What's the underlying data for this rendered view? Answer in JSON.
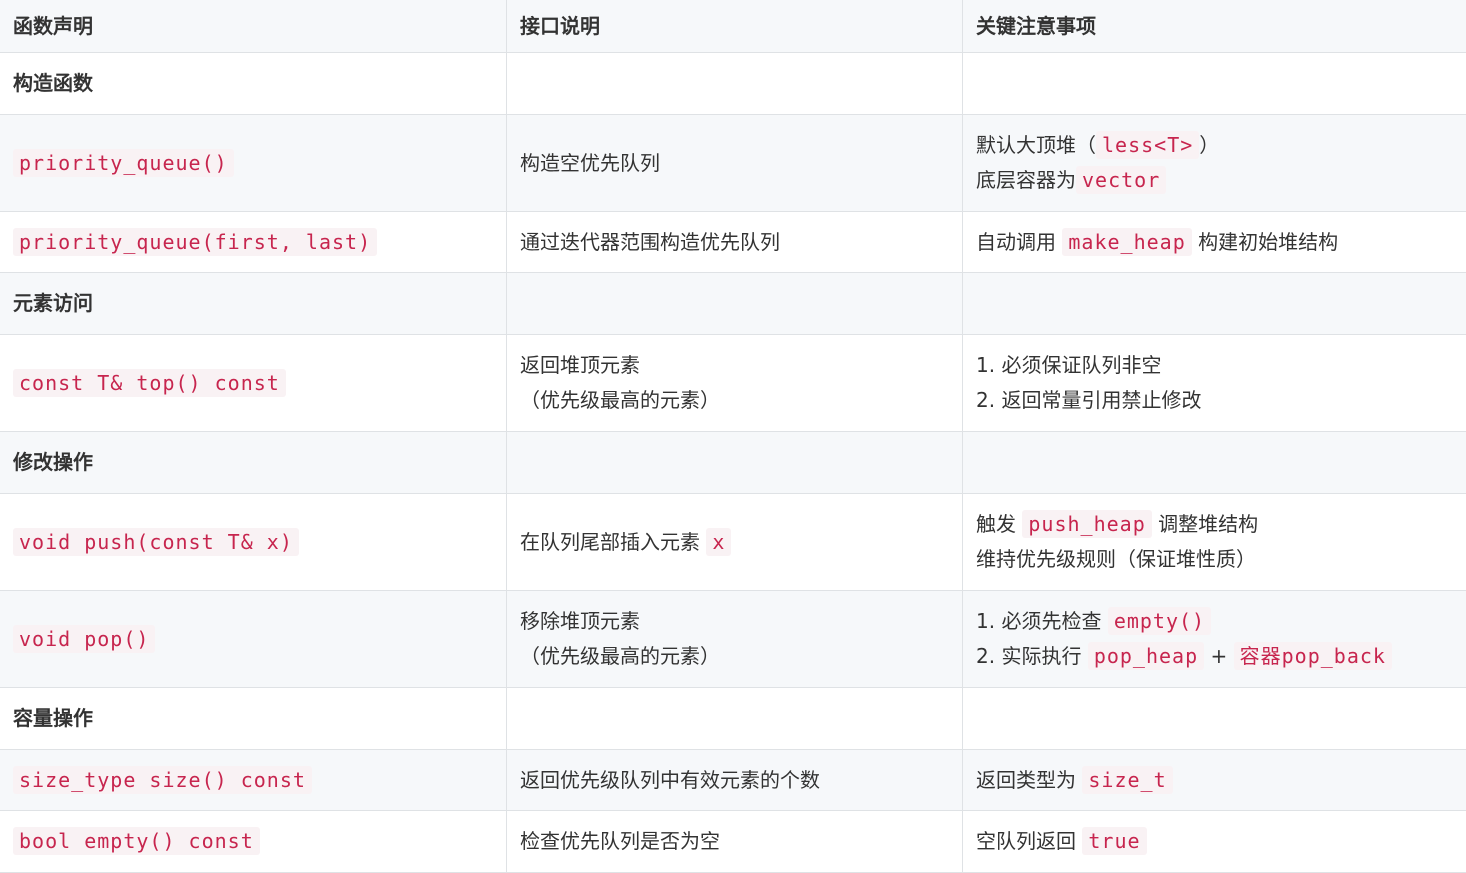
{
  "headers": [
    "函数声明",
    "接口说明",
    "关键注意事项"
  ],
  "sections": {
    "construct": "构造函数",
    "access": "元素访问",
    "modify": "修改操作",
    "capacity": "容量操作"
  },
  "rows": {
    "ctor_default": {
      "decl": "priority_queue()",
      "desc": "构造空优先队列",
      "note1_a": "默认大顶堆（",
      "note1_code": "less<T>",
      "note1_b": "）",
      "note2_a": "底层容器为",
      "note2_code": "vector"
    },
    "ctor_range": {
      "decl": "priority_queue(first, last)",
      "desc": "通过迭代器范围构造优先队列",
      "note_a": "自动调用",
      "note_code": "make_heap",
      "note_b": "构建初始堆结构"
    },
    "top": {
      "decl": "const T& top() const",
      "desc1": "返回堆顶元素",
      "desc2": "（优先级最高的元素）",
      "note1": "1. 必须保证队列非空",
      "note2": "2. 返回常量引用禁止修改"
    },
    "push": {
      "decl": "void push(const T& x)",
      "desc_a": "在队列尾部插入元素",
      "desc_code": "x",
      "note1_a": "触发",
      "note1_code": "push_heap",
      "note1_b": "调整堆结构",
      "note2": "维持优先级规则（保证堆性质）"
    },
    "pop": {
      "decl": "void pop()",
      "desc1": "移除堆顶元素",
      "desc2": "（优先级最高的元素）",
      "note1_a": "1. 必须先检查",
      "note1_code": "empty()",
      "note2_a": "2. 实际执行",
      "note2_code1": "pop_heap",
      "note2_plus": "+",
      "note2_code2": "容器pop_back"
    },
    "size": {
      "decl": "size_type size() const",
      "desc": "返回优先级队列中有效元素的个数",
      "note_a": "返回类型为",
      "note_code": "size_t"
    },
    "empty": {
      "decl": "bool empty() const",
      "desc": "检查优先队列是否为空",
      "note_a": "空队列返回",
      "note_code": "true"
    }
  }
}
